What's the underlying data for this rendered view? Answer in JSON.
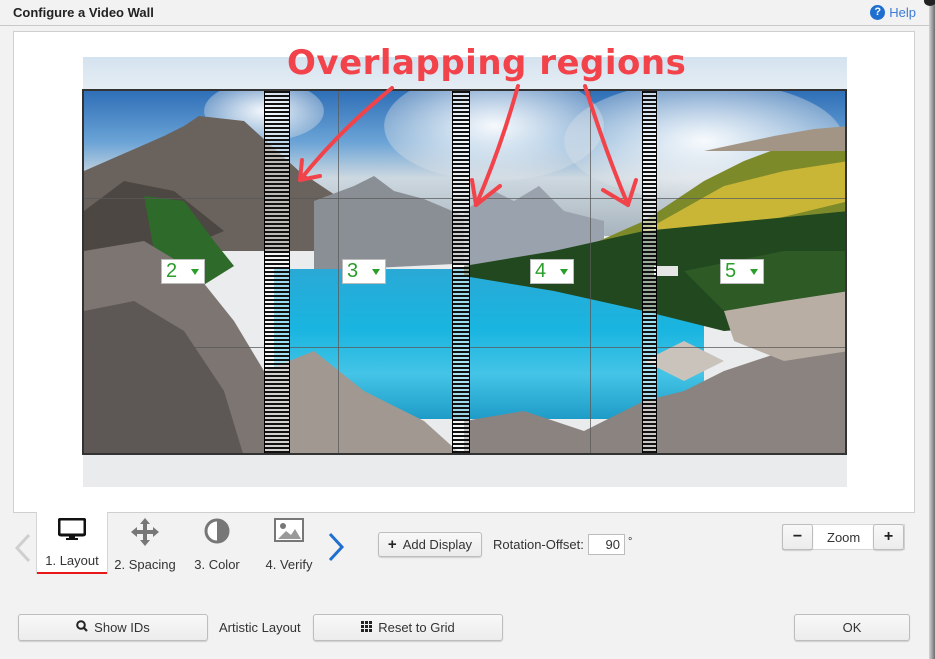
{
  "window": {
    "title": "Configure a Video Wall",
    "help_label": "Help",
    "help_icon": "question-circle-icon"
  },
  "canvas": {
    "annotation_text": "Overlapping regions",
    "annotation_color": "#f2434b",
    "displays": [
      {
        "id": "2"
      },
      {
        "id": "3"
      },
      {
        "id": "4"
      },
      {
        "id": "5"
      }
    ],
    "id_color": "#2a9d2a"
  },
  "steps": {
    "prev_icon": "chevron-left-icon",
    "next_icon": "chevron-right-icon",
    "tabs": [
      {
        "label": "1. Layout",
        "icon": "monitor-icon",
        "active": true
      },
      {
        "label": "2. Spacing",
        "icon": "move-arrows-icon",
        "active": false
      },
      {
        "label": "3. Color",
        "icon": "contrast-icon",
        "active": false
      },
      {
        "label": "4. Verify",
        "icon": "image-icon",
        "active": false
      }
    ],
    "active_color": "#e81818"
  },
  "toolbar": {
    "add_display_label": "Add Display",
    "rotation_label": "Rotation-Offset:",
    "rotation_value": "90",
    "rotation_unit": "°",
    "zoom_label": "Zoom",
    "zoom_out_label": "−",
    "zoom_in_label": "+"
  },
  "footer": {
    "show_ids_label": "Show IDs",
    "artistic_label": "Artistic Layout",
    "reset_grid_label": "Reset to Grid",
    "ok_label": "OK"
  }
}
